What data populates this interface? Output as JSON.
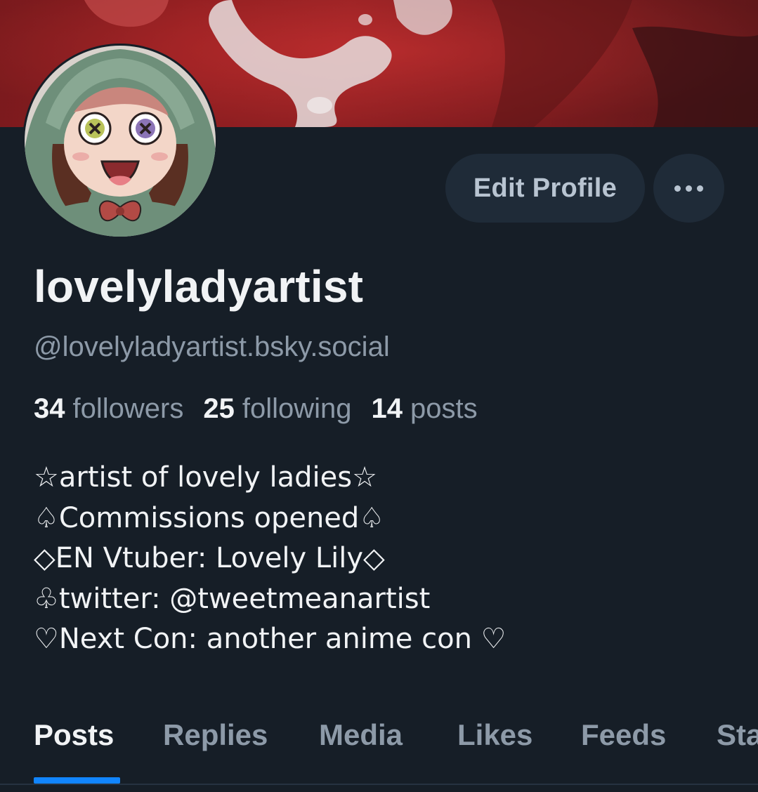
{
  "profile": {
    "display_name": "lovelyladyartist",
    "handle": "@lovelyladyartist.bsky.social",
    "edit_label": "Edit Profile"
  },
  "stats": [
    {
      "value": "34",
      "label": "followers"
    },
    {
      "value": "25",
      "label": "following"
    },
    {
      "value": "14",
      "label": "posts"
    }
  ],
  "bio": [
    "☆artist of lovely ladies☆",
    "♤Commissions opened♤",
    "◇EN Vtuber: Lovely Lily◇",
    "♧twitter: @tweetmeanartist",
    "♡Next Con: another anime con ♡"
  ],
  "tabs": [
    {
      "label": "Posts",
      "active": true
    },
    {
      "label": "Replies",
      "active": false
    },
    {
      "label": "Media",
      "active": false
    },
    {
      "label": "Likes",
      "active": false
    },
    {
      "label": "Feeds",
      "active": false
    },
    {
      "label": "Starter Packs",
      "active": false
    }
  ],
  "icons": {
    "more": "ellipsis-icon",
    "avatar": "avatar-illustration"
  },
  "colors": {
    "background": "#161e27",
    "accent": "#1185fe",
    "muted_text": "#8d9aa8",
    "button_bg": "#1f2b38"
  }
}
